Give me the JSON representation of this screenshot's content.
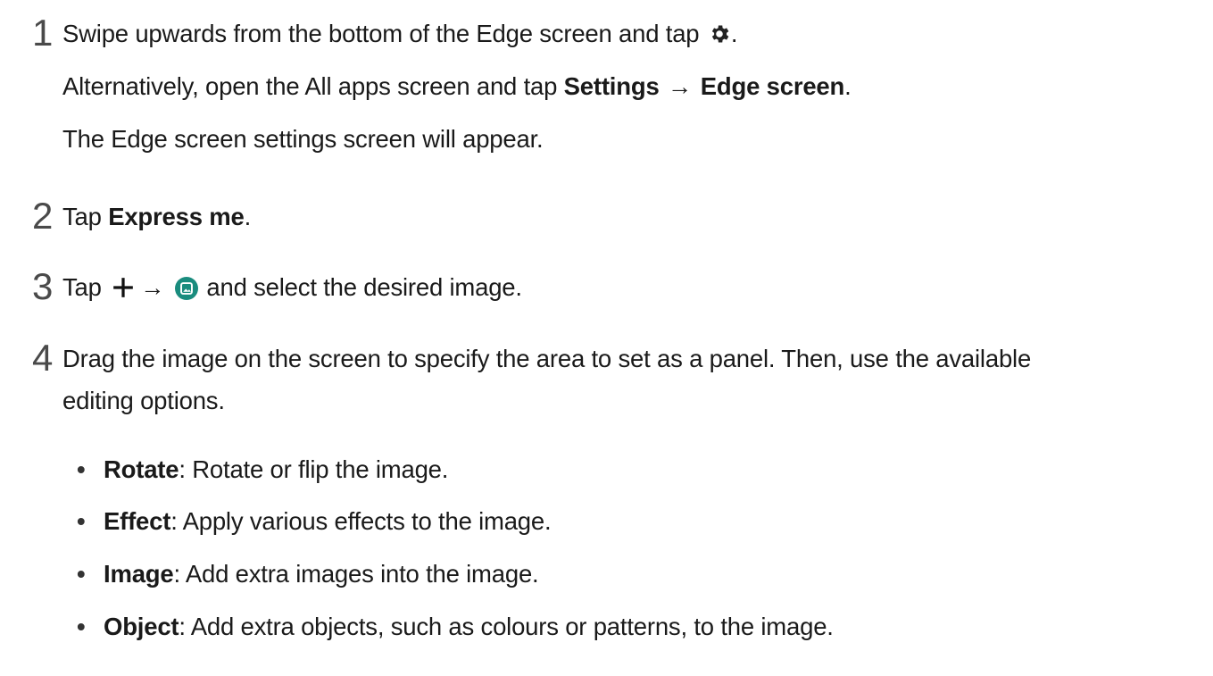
{
  "steps": [
    {
      "number": "1",
      "line1_pre": "Swipe upwards from the bottom of the Edge screen and tap ",
      "line1_post": ".",
      "line2_pre": "Alternatively, open the All apps screen and tap ",
      "line2_bold1": "Settings",
      "line2_arrow": "→",
      "line2_bold2": "Edge screen",
      "line2_post": ".",
      "line3": "The Edge screen settings screen will appear."
    },
    {
      "number": "2",
      "pre": "Tap ",
      "bold": "Express me",
      "post": "."
    },
    {
      "number": "3",
      "pre": "Tap ",
      "arrow": "→",
      "post": " and select the desired image."
    },
    {
      "number": "4",
      "line1": "Drag the image on the screen to specify the area to set as a panel. Then, use the available",
      "line2": "editing options."
    }
  ],
  "options": [
    {
      "bullet": "•",
      "name": "Rotate",
      "desc": ": Rotate or flip the image."
    },
    {
      "bullet": "•",
      "name": "Effect",
      "desc": ": Apply various effects to the image."
    },
    {
      "bullet": "•",
      "name": "Image",
      "desc": ": Add extra images into the image."
    },
    {
      "bullet": "•",
      "name": "Object",
      "desc": ": Add extra objects, such as colours or patterns, to the image."
    }
  ],
  "icons": {
    "settings": "gear-icon",
    "add": "plus-icon",
    "gallery": "gallery-icon"
  },
  "colors": {
    "text": "#1a1a1a",
    "step_number": "#4a4a4a",
    "gallery_icon": "#1a8c7e"
  }
}
